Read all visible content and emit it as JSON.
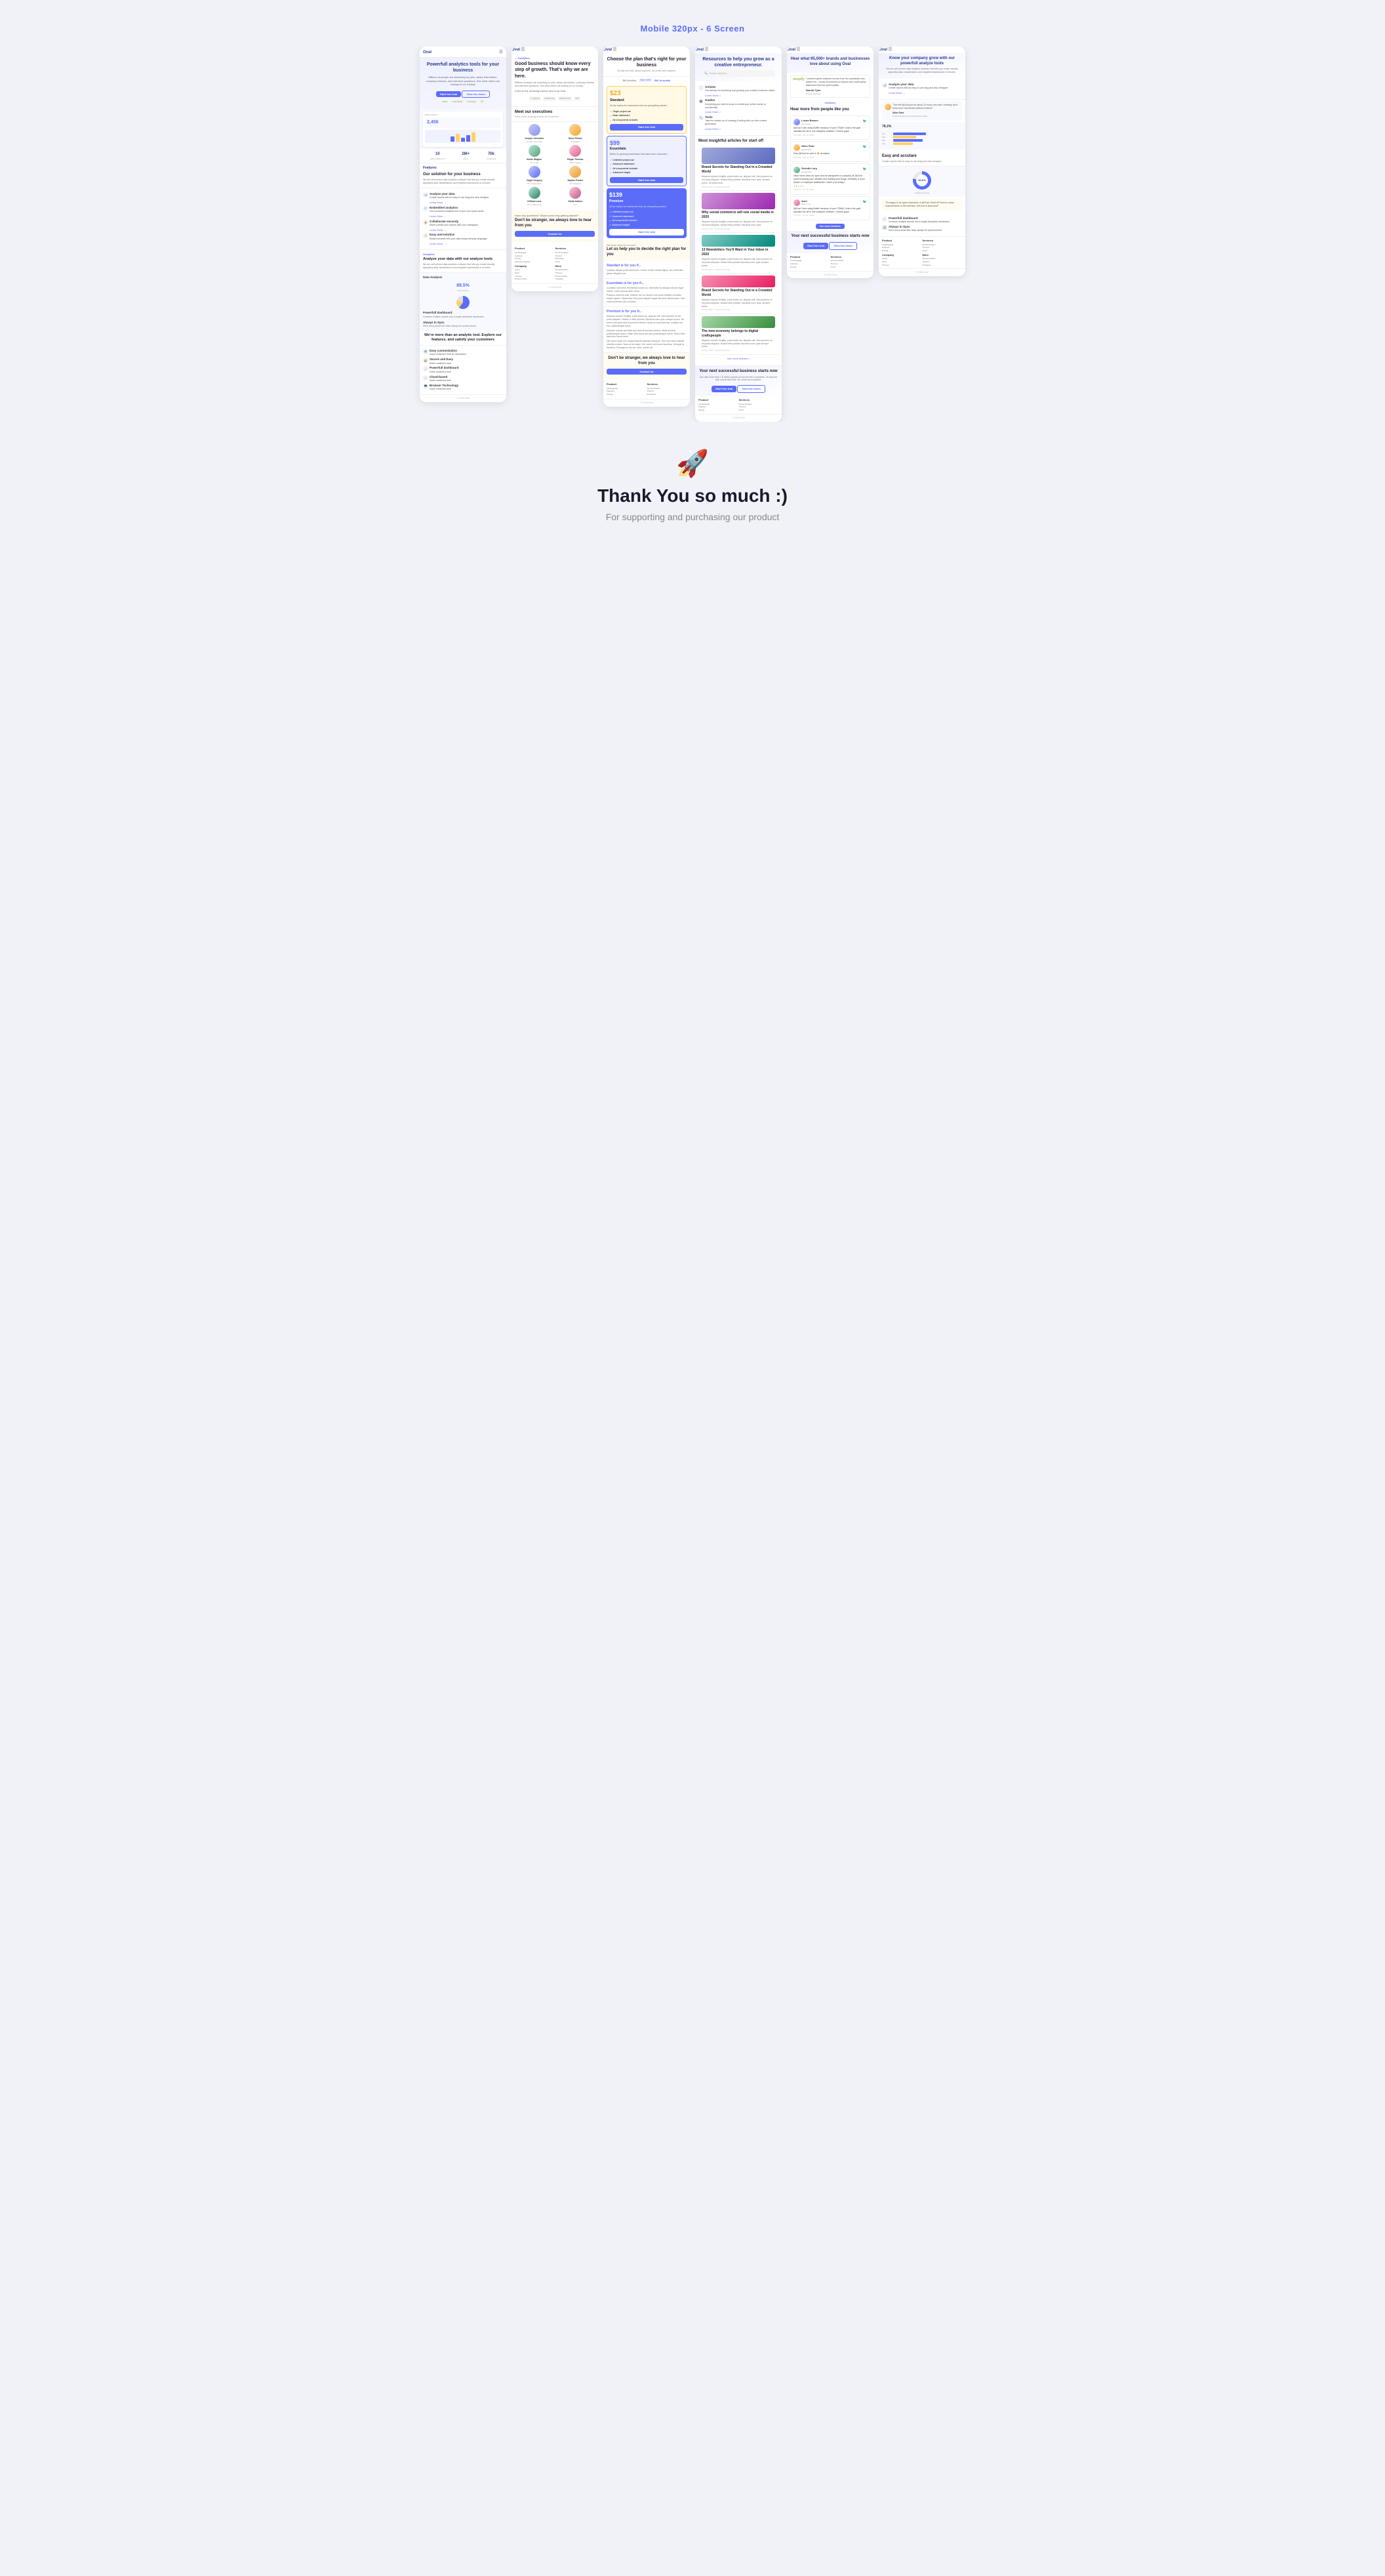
{
  "header": {
    "title": "Mobile 320px - 6 Screen"
  },
  "screens": [
    {
      "id": "screen1",
      "logo": "Oval",
      "hero_title": "Powerfull analytics tools for your business",
      "hero_text": "Millions of people are searching for jobs, salary information, company reviews, and interview questions. See what others are looking for on it today.",
      "btn_primary": "Start free trial",
      "btn_secondary": "View live demo",
      "brands": [
        "slack",
        "mailchimp",
        "HubSpot",
        "SalesForce"
      ],
      "section_features": "Features",
      "feature1_title": "Our solution for your business",
      "feature1_text": "We are self service data analytics software that lets you create visually appealing data visualizations and insightful dashboards in minutes.",
      "feature2_title": "Analyze your data",
      "feature2_text": "Create reports with an easy to use drag and drop designer.",
      "feature3_title": "Embedded analytics",
      "feature3_text": "Get a powerful analytics tool in your own brand name.",
      "feature4_title": "Collaborate securely",
      "feature4_text": "Share publish your reports with your colleagues.",
      "feature5_title": "Easy and Intuitive",
      "feature5_text": "Easily converse with your data using everyday language.",
      "analytics_title": "Analyze your data with our analyze tools",
      "analytics_text": "We are self service data analytics software that lets you create visually appealing data visualizations and insightful dashboards in minutes.",
      "dashboard_title": "Powerfull dashboard",
      "dashboard_text": "Combine multiple reports into a single (beautiful) dashboard.",
      "sync_title": "Always in Sync",
      "sync_text": "Don't worry about this data. Always be synchronized.",
      "metric1": "2,456",
      "metric2": "88.5%",
      "stats": [
        {
          "num": "10",
          "label": "years experience"
        },
        {
          "num": "2M+",
          "label": "users"
        },
        {
          "num": "70k",
          "label": "companies"
        }
      ],
      "bottom_title": "We're more than an analytic tool. Explore our features, and satisfy your customers",
      "footer_text": "Oval",
      "footer_year": "© 2018 Oval"
    },
    {
      "id": "screen2",
      "logo": "Oval",
      "hero_title": "Good business should know every step of growth. That's why we are here.",
      "analytics_label": "— Analytics",
      "hero_text": "Millions of people are searching for jobs, salary information, company reviews, and interview questions. See what others are looking for on it today.",
      "brands_text": "A few of the amazing brands who trust Oval:",
      "meet_title": "Meet our executives",
      "meet_sub": "A few of the amazing brands who trust this!",
      "executives": [
        {
          "name": "Joseph Johnston",
          "role": "Founder and CEO"
        },
        {
          "name": "Steve Parker",
          "role": "President"
        },
        {
          "name": "Nettie Wagner",
          "role": "VP of HR"
        },
        {
          "name": "Edgar Thomas",
          "role": "EVP of Sales"
        },
        {
          "name": "Virgie Gregory",
          "role": "VP of Operations"
        },
        {
          "name": "Jayden Frazier",
          "role": "VP of Finance"
        },
        {
          "name": "Clifford Lane",
          "role": "VP of Marketing"
        },
        {
          "name": "Stella Adkins",
          "role": "CLX"
        }
      ],
      "contact_section": "Have any questions? Share some help getting started?",
      "contact_title": "Don't be stranger, we always love to hear from you",
      "contact_btn": "Contact Us",
      "footer_links": {
        "product": [
          "Landingpage",
          "Features",
          "Pricing",
          "National Program"
        ],
        "services": [
          "Documentation",
          "Themes",
          "Illustration",
          "UI Kit"
        ],
        "company": [
          "About",
          "Work",
          "Themes",
          "Privacy Policy"
        ],
        "more": [
          "Documentation",
          "Themes",
          "Privacy Policy",
          "Charging"
        ]
      },
      "footer_year": "© 2018 Oval"
    },
    {
      "id": "screen3",
      "logo": "Oval",
      "hero_title": "Choose the plan that's right for your business",
      "hero_sub": "30-day free trial, cancel any time. No credit card required.",
      "toggle_monthly": "Bill Monthly",
      "toggle_annual": "Bill Annually",
      "plans": [
        {
          "name": "Standard",
          "price": "$23",
          "period": "/month",
          "desc": "All the basics for businesses that are just getting started.",
          "features": [
            "Single project use",
            "Basic dashboard",
            "All components included"
          ],
          "btn": "Start free trial",
          "style": "standard"
        },
        {
          "name": "Essentials",
          "price": "$99",
          "period": "/month",
          "desc": "Better for growing businesses that want more customers.",
          "features": [
            "Unlimited project use",
            "Advanced dashboard",
            "All components included",
            "Advanced insight"
          ],
          "btn": "Start free trial",
          "style": "essential"
        },
        {
          "name": "Premium",
          "price": "$139",
          "period": "/month",
          "desc": "All the basics for businesses that are just getting started.",
          "features": [
            "Unlimited project use",
            "Advanced dashboard",
            "All components included",
            "Advanced insight"
          ],
          "btn": "Start free trial",
          "style": "premium"
        }
      ],
      "help_title": "Not sure what to choose?",
      "help_sub": "Let us help you to decide the right plan for you",
      "standard_section": "Standart is for you if...",
      "standard_text": "Quisque aliquet porta bibendum. Donec ornare massa ligula, nec venenatis ipsum aliquam non.",
      "essentials_section": "Essentials is for you if...",
      "premium_section": "Premium is for you if...",
      "contact_title": "Don't be stranger, we always love to hear from you",
      "contact_btn": "Contact Us",
      "footer_year": "© 2018 Oval"
    },
    {
      "id": "screen4",
      "logo": "Oval",
      "hero_title": "Resources to help you grow as a creative entrepreneur.",
      "search_placeholder": "Search articles...",
      "categories": [
        {
          "icon": "📄",
          "name": "Articles",
          "desc": "Our fast tips for launching and growing your creative business online.",
          "link": "Learn More >"
        },
        {
          "icon": "📚",
          "name": "Guides",
          "desc": "Everything you need to know to create your online course or membership.",
          "link": "Learn More >"
        },
        {
          "icon": "🔧",
          "name": "Tools",
          "desc": "Take the hassle out of creating & selling with our free content generators.",
          "link": "Learn More >"
        }
      ],
      "most_insightful": "Most insightful articles for start off",
      "articles": [
        {
          "title": "Brand Secrets for Standing Out in a Crowded World",
          "date": "24 May 2020",
          "tag": "Entrepreneurship"
        },
        {
          "title": "Why social commerce will rule social media in 2020",
          "date": "20 May 2020",
          "tag": "Entrepreneurship"
        },
        {
          "title": "13 Newsletters You'll Want in Your Inbox in 2020",
          "date": "20 May 2020",
          "tag": "Entrepreneurship"
        },
        {
          "title": "Brand Secrets for Standing Out in a Crowded World",
          "date": "15 May 2020",
          "tag": "Entrepreneurship"
        },
        {
          "title": "The new economy belongs to digital craftspeople",
          "date": "15 May 2020",
          "tag": "Entrepreneurship"
        }
      ],
      "see_more": "See more articles >",
      "next_biz_title": "Your next successful business starts now",
      "next_biz_text": "Join with more than 1.8 million people across 50,000 companies. 30 day free trial, cancel any time. No credit card required.",
      "btn_trial": "Start free trial",
      "btn_demo": "View live demo",
      "footer_year": "© 2018 Oval"
    },
    {
      "id": "screen5",
      "logo": "Oval",
      "hero_title": "Hear what 95,000+ brands and businesses love about using Oval",
      "shopify_quote": "I received great customer service from the specialists who helped me. I would recommend to anyone who wants great dashboard that has great quality.",
      "shopify_reviewer": "Harold Tyler",
      "shopify_role": "Product Designer",
      "hashtag": "#ovalove",
      "hear_more": "Hear more from people like you",
      "tweets": [
        {
          "name": "Lucas Bowen",
          "handle": "@e_bowen",
          "text": "@Oval I love using Buffer because of your TEAM! Oval is the gold standard for all in one analytics software. Cheers guys!",
          "time": "5:54 PM - Oct 10, 2018"
        },
        {
          "name": "Allen Soto",
          "handle": "@gutterfish",
          "text": "How @Oval for web is 🔥 #ovalove",
          "time": "5:54 PM - Oct 10, 2018"
        },
        {
          "name": "Schultz Lory",
          "handle": "@gutterfish",
          "text": "Have never seen as open and as transparent a company as @Oval. loved browsing your website and reading your blogs. Definitely a torch bearer in employee satisfaction. Iearnt a lot today !",
          "time": "5:54 PM - Oct 10, 2018"
        },
        {
          "name": "Amir",
          "handle": "@amir_12",
          "text": "@Oval I love using Buffer because of your TEAM! Oval is the gold standard for all in one analytics software. Cheers guys!",
          "time": "5:54 PM - Oct 10, 2018"
        }
      ],
      "see_more_oval": "See more #ovalove",
      "next_biz_title": "Your next successful business starts now",
      "btn_trial": "Start free trial",
      "btn_demo": "View live demo",
      "footer_year": "© 2018 Oval"
    },
    {
      "id": "screen6",
      "logo": "Oval",
      "hero_title": "Know your company grow with our powerfull analyze tools",
      "hero_text": "We are self service data analytics software that lets you create visually appealing data visualizations and insightful dashboards in minutes.",
      "analyze_title": "Analyze your data",
      "analyze_text": "Create reports with an easy to use drag and drop designer.",
      "review_text": "\"The hell @Oval put for about 24 hours now and I honestly don't know how I functioned without it before\"",
      "reviewer_name": "Allen Soto",
      "reviewer_role": "Product Designer @ Oval Design Space",
      "progress_pct": "78.2%",
      "easy_title": "Easy and accutare",
      "easy_text": "Create reports with an easy to use drag and drop designer.",
      "donut_value": "60.8%",
      "dashboard_title": "Powerfull dashboard",
      "dashboard_text": "Combine multiple reports into a single (beautiful) dashboard.",
      "sync_title": "Always in Sync",
      "sync_text": "Don't worry about this data, always be synchronized.",
      "footer_links": {
        "product": [
          "Landingpage",
          "Features",
          "Pricing",
          "National Program"
        ],
        "services": [
          "Documentation",
          "Themes",
          "Illustration",
          "UI Kit"
        ],
        "company": [
          "About",
          "Work",
          "Themes",
          "Privacy Policy"
        ],
        "more": [
          "Documentation",
          "Themes",
          "Privacy Policy",
          "Charging"
        ]
      },
      "footer_year": "© 2018 Oval"
    }
  ],
  "thank_you": {
    "title": "Thank You so much :)",
    "subtitle": "For supporting and purchasing our product"
  }
}
